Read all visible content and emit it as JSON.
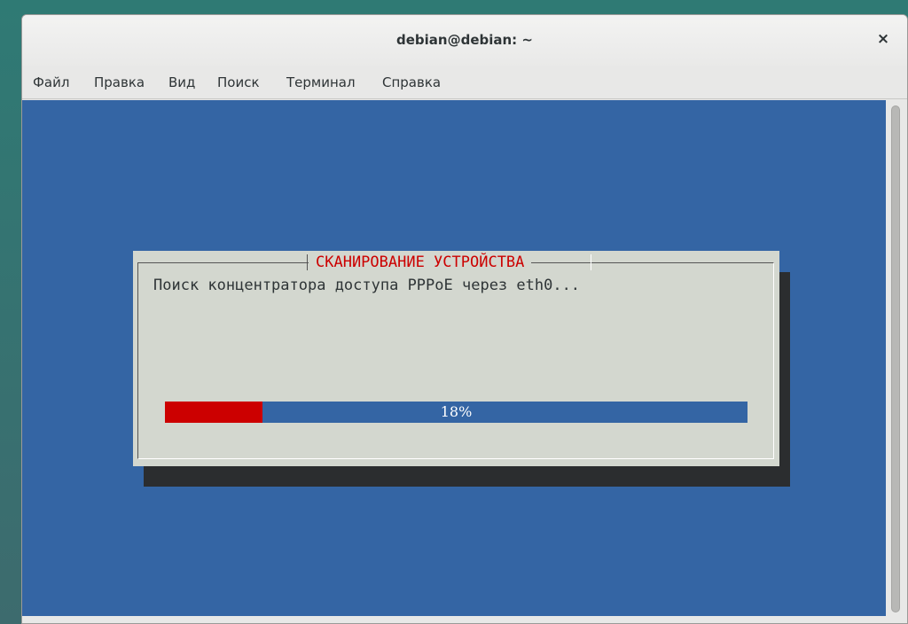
{
  "window": {
    "title": "debian@debian: ~",
    "close_label": "×"
  },
  "menu": {
    "items": [
      {
        "label": "Файл"
      },
      {
        "label": "Правка"
      },
      {
        "label": "Вид"
      },
      {
        "label": "Поиск"
      },
      {
        "label": "Терминал"
      },
      {
        "label": "Справка"
      }
    ]
  },
  "dialog": {
    "title": "СКАНИРОВАНИЕ УСТРОЙСТВА",
    "message": "Поиск концентратора доступа PPPoE через eth0...",
    "progress": {
      "percent": 18,
      "label": "18%"
    }
  },
  "colors": {
    "terminal_bg": "#3465a4",
    "dialog_bg": "#d3d7cf",
    "dialog_title": "#cc0000",
    "progress_fill": "#cc0000",
    "progress_track": "#3465a4"
  }
}
